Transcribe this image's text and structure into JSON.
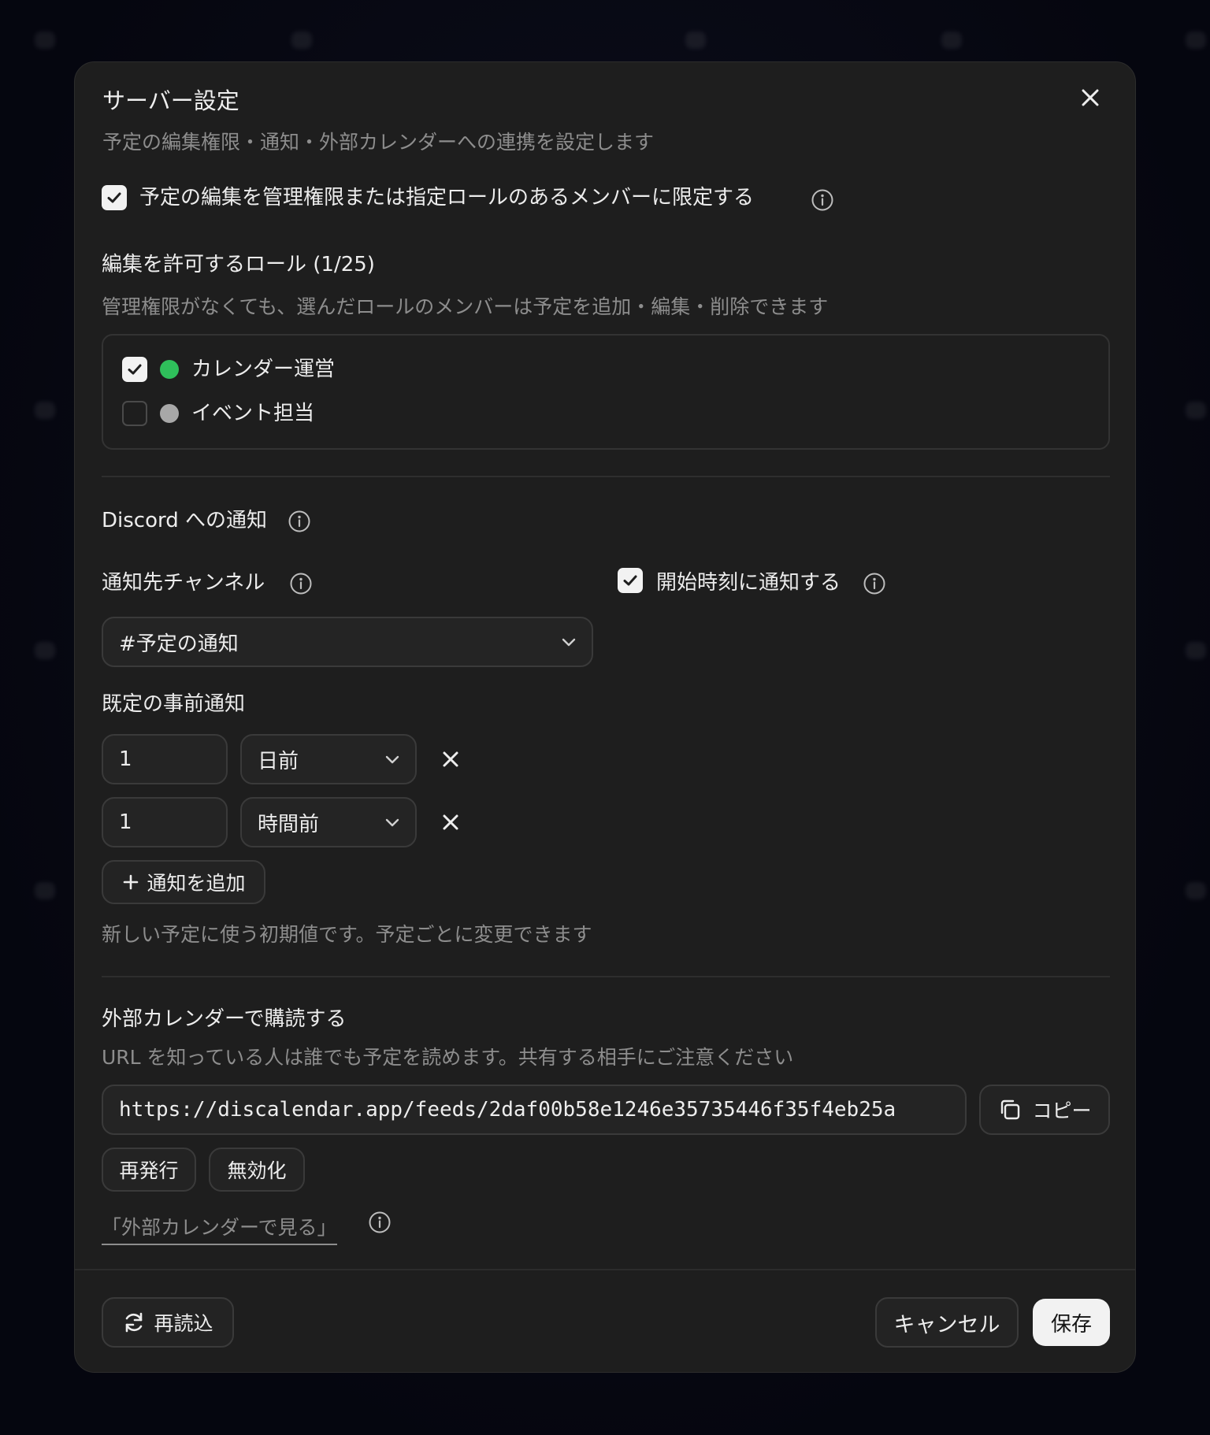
{
  "dialog": {
    "title": "サーバー設定",
    "subtitle": "予定の編集権限・通知・外部カレンダーへの連携を設定します"
  },
  "restrict_edit": {
    "checked": true,
    "label": "予定の編集を管理権限または指定ロールのあるメンバーに限定する"
  },
  "roles": {
    "title": "編集を許可するロール (1/25)",
    "hint": "管理権限がなくても、選んだロールのメンバーは予定を追加・編集・削除できます",
    "items": [
      {
        "label": "カレンダー運営",
        "checked": true,
        "color": "#2fbf5b"
      },
      {
        "label": "イベント担当",
        "checked": false,
        "color": "#a8a8a8"
      }
    ]
  },
  "discord": {
    "title": "Discord への通知",
    "channel_label": "通知先チャンネル",
    "channel_value": "#予定の通知",
    "notify_start": {
      "checked": true,
      "label": "開始時刻に通知する"
    },
    "reminders_label": "既定の事前通知",
    "reminders": [
      {
        "amount": "1",
        "unit": "日前"
      },
      {
        "amount": "1",
        "unit": "時間前"
      }
    ],
    "add_button": "通知を追加",
    "reminders_hint": "新しい予定に使う初期値です。予定ごとに変更できます"
  },
  "feed": {
    "title": "外部カレンダーで購読する",
    "hint": "URL を知っている人は誰でも予定を読めます。共有する相手にご注意ください",
    "url": "https://discalendar.app/feeds/2daf00b58e1246e35735446f35f4eb25a",
    "copy_button": "コピー",
    "reissue_button": "再発行",
    "disable_button": "無効化",
    "view_link": "「外部カレンダーで見る」"
  },
  "footer": {
    "reload_button": "再読込",
    "cancel_button": "キャンセル",
    "save_button": "保存"
  },
  "colors": {
    "dialog_bg": "#1e1e1e",
    "accent_white": "#f2f2f2",
    "muted_text": "#8d8d8d"
  }
}
